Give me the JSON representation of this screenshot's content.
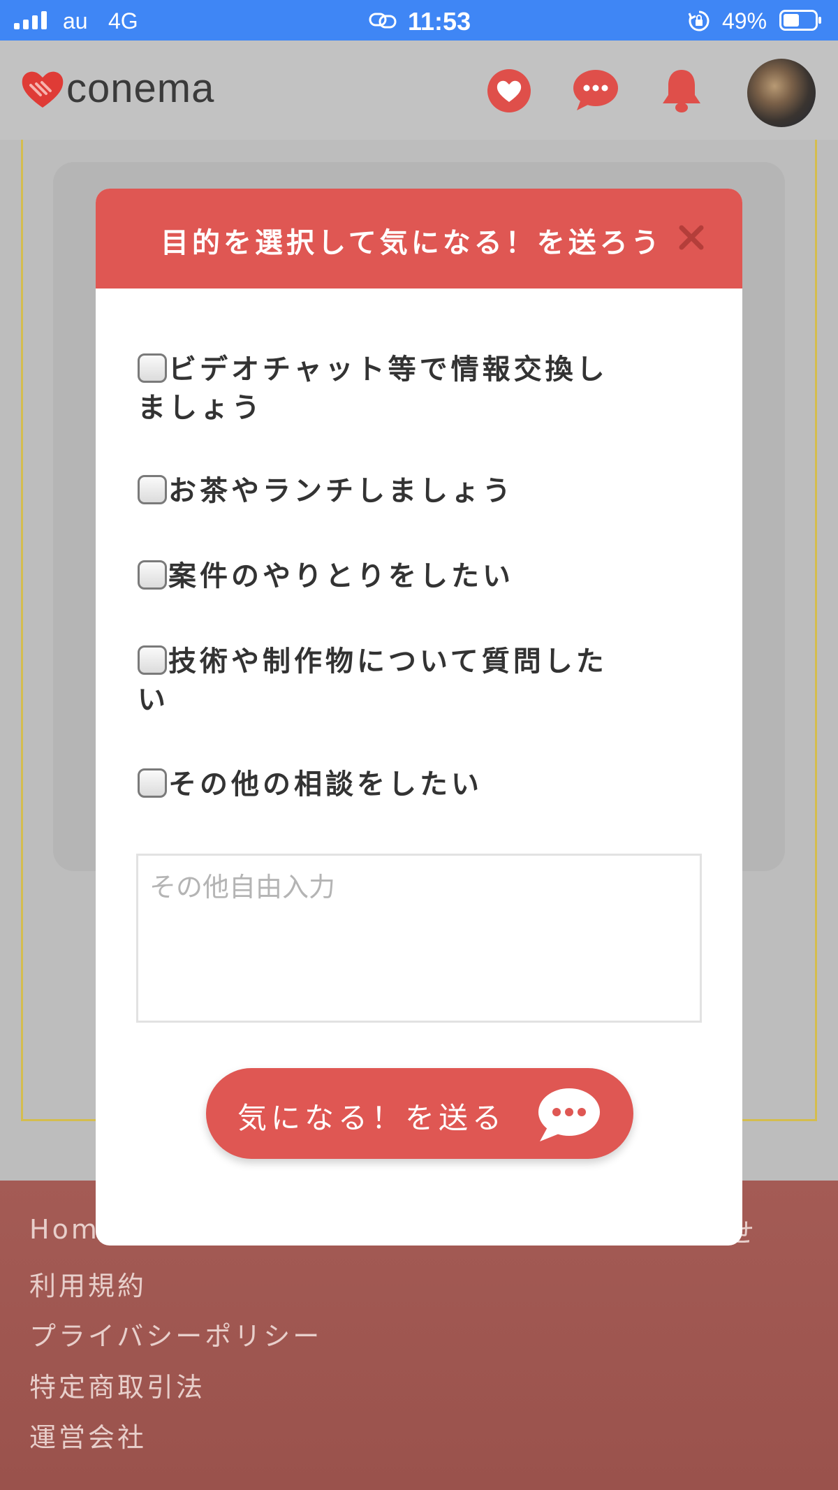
{
  "status_bar": {
    "carrier": "au",
    "network": "4G",
    "time": "11:53",
    "battery_percent": "49%",
    "battery_level": 0.49,
    "signal_bars": 4
  },
  "header": {
    "logo_text": "conema",
    "icons": [
      "heart-icon",
      "chat-icon",
      "bell-icon"
    ],
    "accent_color": "#df5753"
  },
  "modal": {
    "title": "目的を選択して気になる！を送ろう",
    "options": [
      "ビデオチャット等で情報交換しましょう",
      "お茶やランチしましょう",
      "案件のやりとりをしたい",
      "技術や制作物について質問したい",
      "その他の相談をしたい"
    ],
    "free_input_placeholder": "その他自由入力",
    "free_input_value": "",
    "send_label": "気になる！を送る"
  },
  "footer": {
    "links": [
      "Home",
      "利用規約",
      "プライバシーポリシー",
      "特定商取引法",
      "運営会社"
    ],
    "partial_link_right": "わせ"
  }
}
